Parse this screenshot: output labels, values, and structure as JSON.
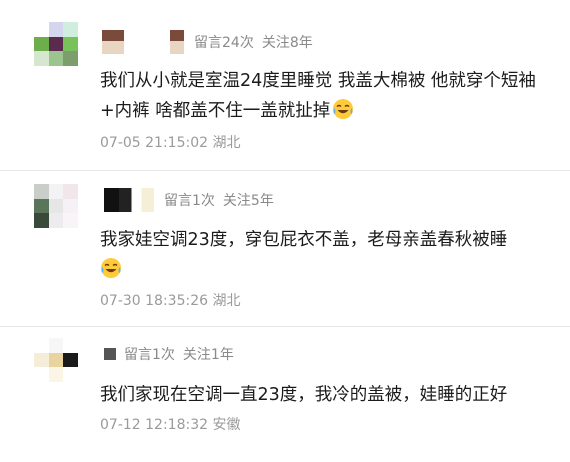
{
  "comments": [
    {
      "stats": {
        "messages": "留言24次",
        "follow": "关注8年"
      },
      "text": "我们从小就是室温24度里睡觉 我盖大棉被 他就穿个短袖+内裤 啥都盖不住一盖就扯掉",
      "emoji": "laughing-crying-emoji",
      "time": "07-05 21:15:02 湖北",
      "avatar_colors": [
        "#ffffff",
        "#d4d6ee",
        "#cfeedd",
        "#6cae4a",
        "#5a2a4f",
        "#78c25c",
        "#d7e7cf",
        "#9bc48f",
        "#7c9e6c"
      ]
    },
    {
      "stats": {
        "messages": "留言1次",
        "follow": "关注5年"
      },
      "text": "我家娃空调23度，穿包屁衣不盖，老母亲盖春秋被睡",
      "emoji": "laughing-crying-emoji",
      "time": "07-30 18:35:26 湖北",
      "avatar_colors": [
        "#c9cec9",
        "#f4f2f4",
        "#f1e7eb",
        "#59755a",
        "#e6e6e6",
        "#f5f1f4",
        "#3a4a3a",
        "#eeebee",
        "#f7f5f7"
      ]
    },
    {
      "stats": {
        "messages": "留言1次",
        "follow": "关注1年"
      },
      "text": "我们家现在空调一直23度，我冷的盖被，娃睡的正好",
      "emoji": "",
      "time": "07-12 12:18:32 安徽",
      "avatar_colors": [
        "#ffffff",
        "#f7f7f7",
        "#ffffff",
        "#f5edd7",
        "#ead49d",
        "#1a1a1a",
        "#ffffff",
        "#fbf5e6",
        "#ffffff"
      ]
    }
  ],
  "icons": {
    "stat_marker": "square-bullet-icon"
  }
}
